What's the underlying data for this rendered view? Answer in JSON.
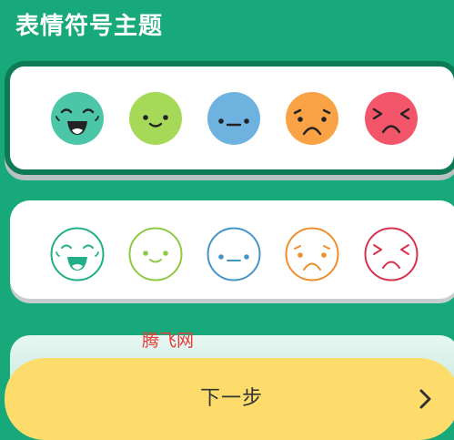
{
  "header": {
    "title": "表情符号主题"
  },
  "themes": [
    {
      "name": "filled",
      "selected": true,
      "faces": [
        {
          "mood": "laughing",
          "color": "#4cc6a8"
        },
        {
          "mood": "smiling",
          "color": "#a6d957"
        },
        {
          "mood": "neutral",
          "color": "#6eb3df"
        },
        {
          "mood": "sad",
          "color": "#f9a246"
        },
        {
          "mood": "upset",
          "color": "#f3566b"
        }
      ]
    },
    {
      "name": "outline",
      "selected": false,
      "faces": [
        {
          "mood": "laughing",
          "color": "#22ae86"
        },
        {
          "mood": "smiling",
          "color": "#8fc944"
        },
        {
          "mood": "neutral",
          "color": "#4596c6"
        },
        {
          "mood": "sad",
          "color": "#ee8f2d"
        },
        {
          "mood": "upset",
          "color": "#d9304e"
        }
      ]
    }
  ],
  "watermark": "腾飞网",
  "footer": {
    "next_label": "下一步",
    "next_icon": "chevron-right-icon",
    "button_color": "#fedc6c"
  }
}
